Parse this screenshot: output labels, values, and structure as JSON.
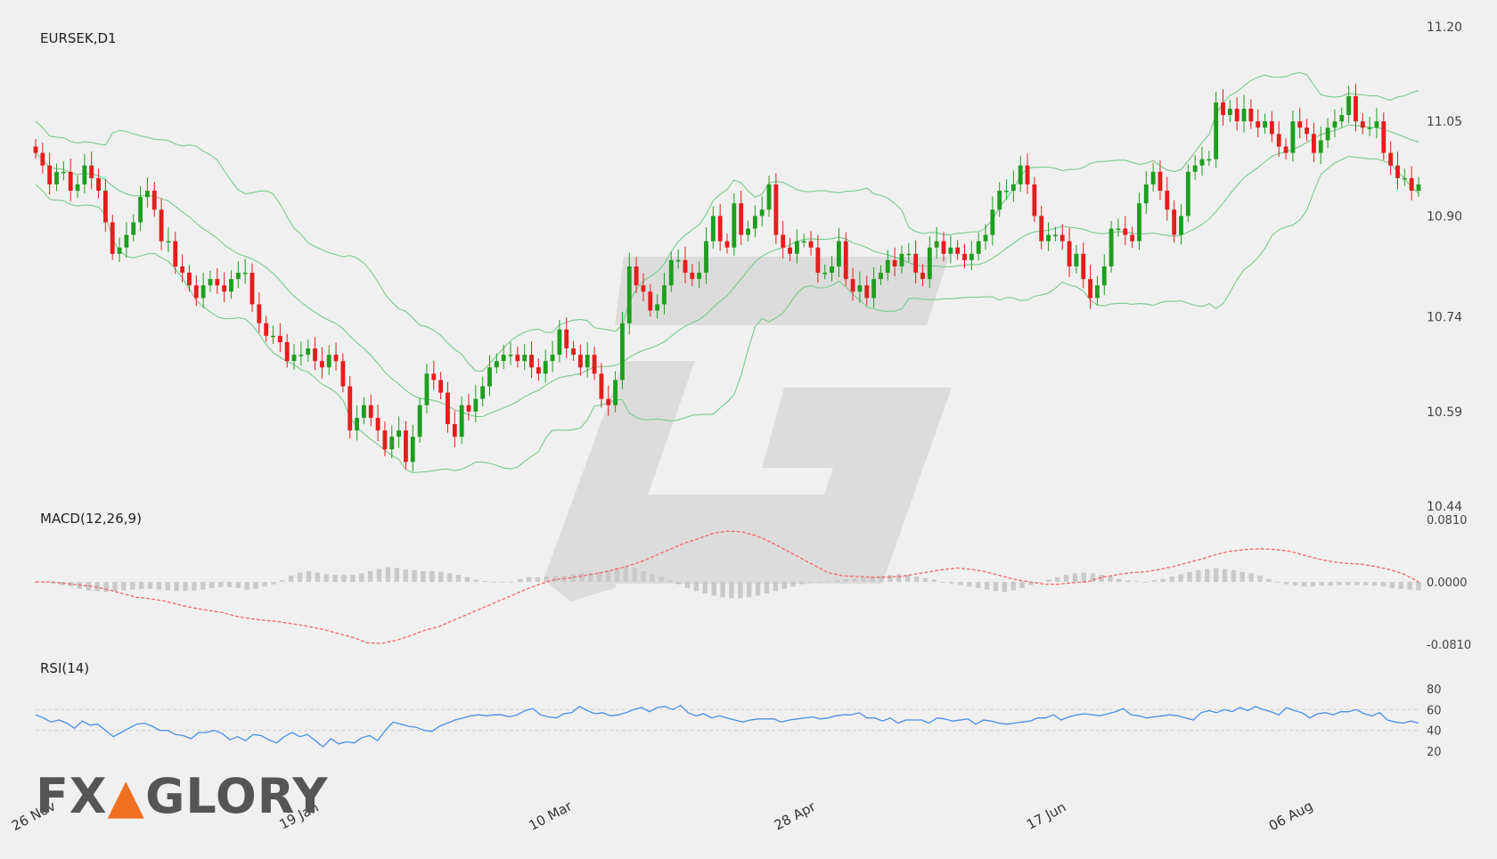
{
  "brand": {
    "logo_text": "FXGLORY",
    "accent_color": "#f07020"
  },
  "colors": {
    "up": "#1e9e1e",
    "down": "#e51d1d",
    "bands": "#7cc98c",
    "macd_signal": "#f06a6a",
    "macd_hist": "#c9c9c9",
    "rsi": "#4a8fe8",
    "watermark": "#dcdcdc"
  },
  "chart_data": [
    {
      "type": "candlestick",
      "title": "EURSEK,D1",
      "overlay": "bollinger-bands",
      "yticks": [
        "11.20",
        "11.05",
        "10.90",
        "10.74",
        "10.59",
        "10.44"
      ],
      "ylim": [
        10.44,
        11.2
      ],
      "xticks": [
        {
          "label": "26 Nov",
          "index": 0
        },
        {
          "label": "19 Jan",
          "index": 38
        },
        {
          "label": "10 Mar",
          "index": 74
        },
        {
          "label": "28 Apr",
          "index": 109
        },
        {
          "label": "17 Jun",
          "index": 145
        },
        {
          "label": "06 Aug",
          "index": 180
        }
      ],
      "closes": [
        11.0,
        10.98,
        10.95,
        10.97,
        10.97,
        10.94,
        10.95,
        10.98,
        10.96,
        10.94,
        10.89,
        10.84,
        10.85,
        10.87,
        10.89,
        10.93,
        10.94,
        10.91,
        10.86,
        10.86,
        10.82,
        10.81,
        10.79,
        10.77,
        10.79,
        10.8,
        10.79,
        10.78,
        10.8,
        10.81,
        10.81,
        10.76,
        10.73,
        10.71,
        10.71,
        10.7,
        10.67,
        10.68,
        10.68,
        10.69,
        10.67,
        10.66,
        10.68,
        10.67,
        10.63,
        10.56,
        10.58,
        10.6,
        10.58,
        10.56,
        10.53,
        10.55,
        10.56,
        10.51,
        10.55,
        10.6,
        10.65,
        10.64,
        10.62,
        10.57,
        10.55,
        10.6,
        10.59,
        10.61,
        10.63,
        10.66,
        10.67,
        10.68,
        10.68,
        10.67,
        10.68,
        10.66,
        10.65,
        10.67,
        10.68,
        10.72,
        10.69,
        10.68,
        10.66,
        10.68,
        10.65,
        10.61,
        10.6,
        10.64,
        10.73,
        10.82,
        10.79,
        10.78,
        10.75,
        10.76,
        10.79,
        10.83,
        10.83,
        10.81,
        10.8,
        10.81,
        10.86,
        10.9,
        10.86,
        10.85,
        10.92,
        10.87,
        10.88,
        10.9,
        10.91,
        10.95,
        10.87,
        10.85,
        10.84,
        10.86,
        10.86,
        10.85,
        10.81,
        10.81,
        10.82,
        10.86,
        10.8,
        10.78,
        10.79,
        10.77,
        10.8,
        10.81,
        10.83,
        10.82,
        10.84,
        10.84,
        10.81,
        10.8,
        10.85,
        10.86,
        10.84,
        10.85,
        10.84,
        10.83,
        10.84,
        10.86,
        10.87,
        10.91,
        10.94,
        10.94,
        10.95,
        10.98,
        10.95,
        10.9,
        10.86,
        10.87,
        10.87,
        10.86,
        10.82,
        10.84,
        10.8,
        10.77,
        10.79,
        10.82,
        10.88,
        10.88,
        10.87,
        10.86,
        10.92,
        10.95,
        10.97,
        10.94,
        10.91,
        10.87,
        10.9,
        10.97,
        10.98,
        10.99,
        10.99,
        11.08,
        11.06,
        11.07,
        11.05,
        11.07,
        11.05,
        11.04,
        11.05,
        11.03,
        11.01,
        11.0,
        11.05,
        11.04,
        11.03,
        11.0,
        11.02,
        11.04,
        11.05,
        11.06,
        11.09,
        11.05,
        11.04,
        11.04,
        11.05,
        11.0,
        10.98,
        10.96,
        10.96,
        10.94,
        10.95
      ]
    },
    {
      "type": "line",
      "title": "MACD(12,26,9)",
      "yticks": [
        "0.0810",
        "0.0000",
        "-0.0810"
      ],
      "ylim": [
        -0.081,
        0.081
      ],
      "series": [
        {
          "name": "signal",
          "values": [
            0.0,
            0.0,
            -0.002,
            -0.004,
            -0.006,
            -0.01,
            -0.015,
            -0.02,
            -0.022,
            -0.025,
            -0.03,
            -0.034,
            -0.037,
            -0.04,
            -0.045,
            -0.048,
            -0.05,
            -0.052,
            -0.055,
            -0.058,
            -0.062,
            -0.067,
            -0.072,
            -0.079,
            -0.08,
            -0.076,
            -0.07,
            -0.063,
            -0.058,
            -0.05,
            -0.042,
            -0.034,
            -0.026,
            -0.018,
            -0.01,
            -0.003,
            0.003,
            0.005,
            0.008,
            0.011,
            0.015,
            0.02,
            0.026,
            0.034,
            0.042,
            0.05,
            0.056,
            0.063,
            0.066,
            0.065,
            0.06,
            0.052,
            0.042,
            0.032,
            0.022,
            0.012,
            0.008,
            0.007,
            0.006,
            0.006,
            0.007,
            0.01,
            0.013,
            0.016,
            0.018,
            0.016,
            0.013,
            0.008,
            0.003,
            0.0,
            -0.003,
            -0.003,
            -0.001,
            0.0,
            0.006,
            0.009,
            0.012,
            0.013,
            0.016,
            0.02,
            0.025,
            0.03,
            0.036,
            0.04,
            0.042,
            0.043,
            0.042,
            0.04,
            0.035,
            0.03,
            0.026,
            0.024,
            0.023,
            0.02,
            0.016,
            0.01,
            0.0
          ]
        }
      ],
      "histogram": [
        0.0,
        0.0,
        -0.002,
        -0.004,
        -0.006,
        -0.009,
        -0.011,
        -0.012,
        -0.013,
        -0.012,
        -0.011,
        -0.01,
        -0.009,
        -0.009,
        -0.01,
        -0.011,
        -0.012,
        -0.012,
        -0.011,
        -0.01,
        -0.008,
        -0.007,
        -0.007,
        -0.008,
        -0.01,
        -0.009,
        -0.006,
        -0.003,
        0.002,
        0.008,
        0.012,
        0.014,
        0.012,
        0.01,
        0.009,
        0.009,
        0.009,
        0.011,
        0.014,
        0.017,
        0.019,
        0.018,
        0.016,
        0.015,
        0.014,
        0.014,
        0.013,
        0.011,
        0.009,
        0.006,
        0.003,
        0.001,
        0.0,
        0.0,
        0.0,
        0.004,
        0.006,
        0.006,
        0.007,
        0.007,
        0.008,
        0.01,
        0.011,
        0.012,
        0.013,
        0.015,
        0.018,
        0.02,
        0.018,
        0.014,
        0.01,
        0.006,
        0.002,
        -0.003,
        -0.008,
        -0.012,
        -0.015,
        -0.018,
        -0.02,
        -0.021,
        -0.021,
        -0.02,
        -0.018,
        -0.015,
        -0.012,
        -0.009,
        -0.006,
        -0.003,
        -0.001,
        0.0,
        0.001,
        0.002,
        0.003,
        0.004,
        0.005,
        0.006,
        0.008,
        0.009,
        0.01,
        0.009,
        0.007,
        0.005,
        0.003,
        0.0,
        -0.002,
        -0.004,
        -0.006,
        -0.008,
        -0.01,
        -0.012,
        -0.013,
        -0.011,
        -0.008,
        -0.004,
        0.0,
        0.003,
        0.006,
        0.009,
        0.011,
        0.012,
        0.011,
        0.009,
        0.007,
        0.004,
        0.002,
        0.001,
        0.0,
        0.002,
        0.004,
        0.007,
        0.01,
        0.013,
        0.015,
        0.017,
        0.018,
        0.017,
        0.015,
        0.013,
        0.011,
        0.008,
        0.004,
        0.0,
        -0.003,
        -0.005,
        -0.006,
        -0.006,
        -0.005,
        -0.005,
        -0.004,
        -0.004,
        -0.004,
        -0.004,
        -0.005,
        -0.006,
        -0.008,
        -0.009,
        -0.01,
        -0.011
      ]
    },
    {
      "type": "line",
      "title": "RSI(14)",
      "yticks": [
        "80",
        "60",
        "40",
        "20"
      ],
      "ylim": [
        20,
        80
      ],
      "series": [
        {
          "name": "rsi",
          "values": [
            55,
            52,
            48,
            50,
            47,
            42,
            49,
            45,
            46,
            40,
            34,
            38,
            42,
            46,
            47,
            44,
            40,
            40,
            36,
            35,
            32,
            38,
            38,
            40,
            37,
            31,
            34,
            30,
            36,
            35,
            31,
            28,
            34,
            38,
            34,
            36,
            30,
            24,
            32,
            27,
            29,
            28,
            33,
            35,
            30,
            40,
            48,
            46,
            44,
            43,
            40,
            39,
            44,
            47,
            50,
            52,
            54,
            55,
            54,
            55,
            55,
            53,
            55,
            59,
            61,
            55,
            53,
            52,
            56,
            57,
            63,
            59,
            56,
            57,
            54,
            55,
            57,
            60,
            62,
            58,
            62,
            63,
            60,
            64,
            57,
            54,
            56,
            52,
            54,
            52,
            50,
            48,
            50,
            51,
            51,
            51,
            48,
            50,
            51,
            52,
            53,
            51,
            52,
            54,
            55,
            55,
            57,
            52,
            52,
            49,
            52,
            47,
            50,
            50,
            50,
            47,
            52,
            51,
            49,
            50,
            51,
            46,
            50,
            49,
            47,
            46,
            47,
            48,
            49,
            52,
            52,
            55,
            50,
            53,
            55,
            56,
            55,
            54,
            56,
            58,
            61,
            55,
            54,
            52,
            53,
            54,
            55,
            54,
            52,
            50,
            57,
            59,
            57,
            60,
            58,
            62,
            59,
            63,
            60,
            58,
            55,
            62,
            59,
            57,
            52,
            56,
            57,
            55,
            58,
            58,
            60,
            56,
            54,
            57,
            50,
            48,
            47,
            49,
            47
          ]
        }
      ],
      "reference_lines": [
        60,
        40
      ]
    }
  ]
}
